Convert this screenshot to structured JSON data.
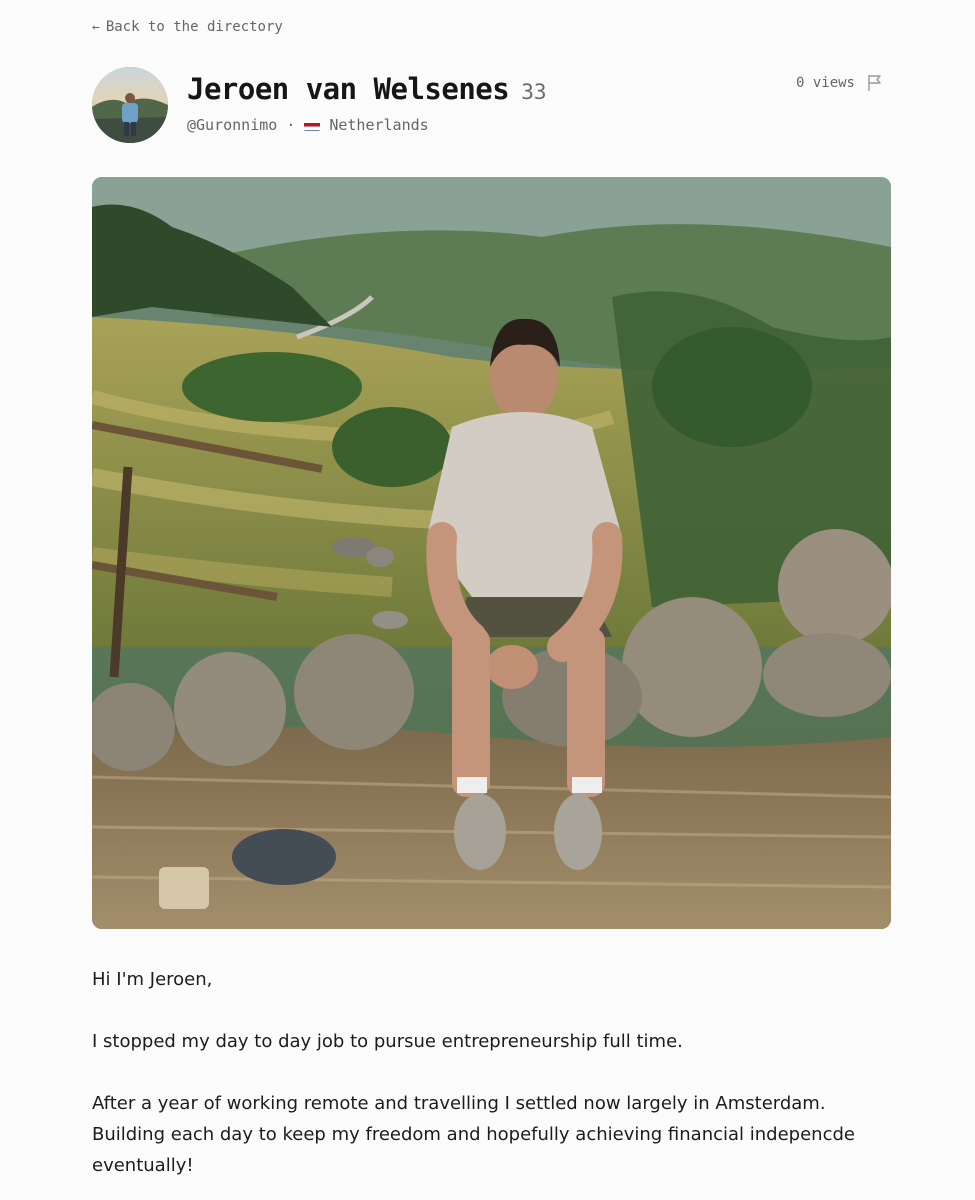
{
  "nav": {
    "back_label": "Back to the directory",
    "back_icon": "arrow-left-icon"
  },
  "profile": {
    "name": "Jeroen van Welsenes",
    "age": "33",
    "handle": "@Guronnimo",
    "separator": "·",
    "country": "Netherlands",
    "country_flag": "netherlands-flag-icon",
    "views": "0 views",
    "report_icon": "flag-icon"
  },
  "bio": {
    "paragraphs": [
      "Hi I'm Jeroen,",
      "I stopped my day to day job to pursue entrepreneurship full time.",
      "After a year of working remote and travelling I settled now largely in Amsterdam. Building each day to keep my freedom and hopefully achieving financial indepencde eventually!"
    ]
  },
  "colors": {
    "background": "#fbfbfb",
    "text": "#1a1a1a",
    "muted": "#666666"
  }
}
